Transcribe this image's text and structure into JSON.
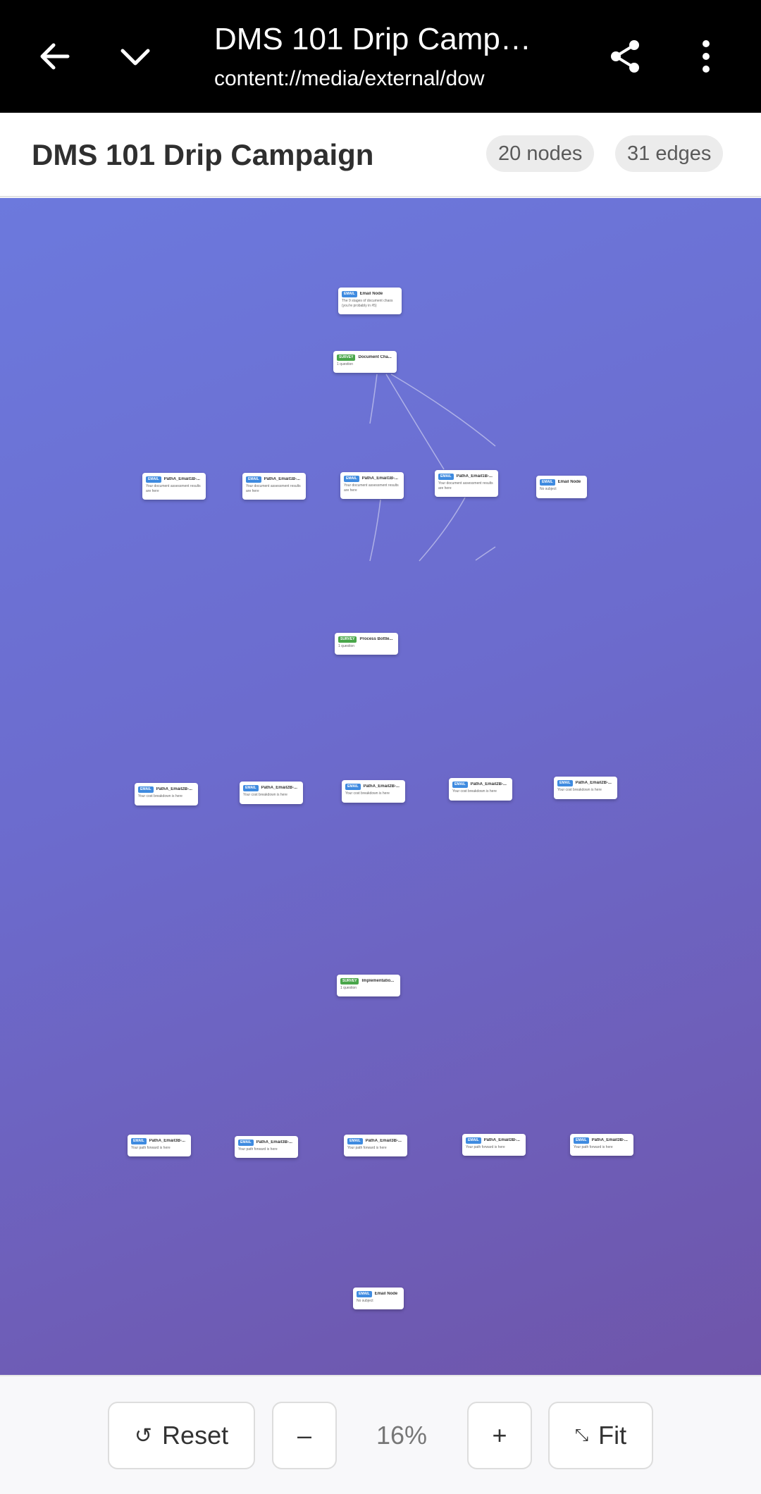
{
  "app_bar": {
    "title": "DMS 101 Drip Campai...",
    "url": "content://media/external/dow",
    "icons": [
      "back-arrow-icon",
      "chevron-down-icon",
      "share-icon",
      "more-vert-icon"
    ]
  },
  "header": {
    "title": "DMS 101 Drip Campaign",
    "nodes_count": "20 nodes",
    "edges_count": "31 edges"
  },
  "graph": {
    "background_colors": [
      "#6c79dd",
      "#6f55aa"
    ],
    "nodes": [
      {
        "type": "EMAIL",
        "title": "Email Node",
        "subtitle": "The 9 stages of document chaos (you're probably in #5)"
      },
      {
        "type": "SURVEY",
        "title": "Document Cha...",
        "subtitle": "1 question"
      },
      {
        "type": "EMAIL",
        "title": "PathA_Email1B-...",
        "subtitle": "Your document assessment results are here"
      },
      {
        "type": "EMAIL",
        "title": "PathA_Email1B-...",
        "subtitle": "Your document assessment results are here"
      },
      {
        "type": "EMAIL",
        "title": "PathA_Email1B-...",
        "subtitle": "Your document assessment results are here"
      },
      {
        "type": "EMAIL",
        "title": "PathA_Email1B-...",
        "subtitle": "Your document assessment results are here"
      },
      {
        "type": "EMAIL",
        "title": "Email Node",
        "subtitle": "No subject"
      },
      {
        "type": "SURVEY",
        "title": "Process Bottle...",
        "subtitle": "1 question"
      },
      {
        "type": "EMAIL",
        "title": "PathA_Email2B-...",
        "subtitle": "Your cost breakdown is here"
      },
      {
        "type": "EMAIL",
        "title": "PathA_Email2B-...",
        "subtitle": "Your cost breakdown is here"
      },
      {
        "type": "EMAIL",
        "title": "PathA_Email2B-...",
        "subtitle": "Your cost breakdown is here"
      },
      {
        "type": "EMAIL",
        "title": "PathA_Email2B-...",
        "subtitle": "Your cost breakdown is here"
      },
      {
        "type": "EMAIL",
        "title": "PathA_Email2B-...",
        "subtitle": "Your cost breakdown is here"
      },
      {
        "type": "SURVEY",
        "title": "Implementatio...",
        "subtitle": "1 question"
      },
      {
        "type": "EMAIL",
        "title": "PathA_Email3B-...",
        "subtitle": "Your path forward is here"
      },
      {
        "type": "EMAIL",
        "title": "PathA_Email3B-...",
        "subtitle": "Your path forward is here"
      },
      {
        "type": "EMAIL",
        "title": "PathA_Email3B-...",
        "subtitle": "Your path forward is here"
      },
      {
        "type": "EMAIL",
        "title": "PathA_Email3B-...",
        "subtitle": "Your path forward is here"
      },
      {
        "type": "EMAIL",
        "title": "PathA_Email3B-...",
        "subtitle": "Your path forward is here"
      },
      {
        "type": "EMAIL",
        "title": "Email Node",
        "subtitle": "No subject"
      }
    ]
  },
  "controls": {
    "reset_label": "Reset",
    "reset_icon": "reset-icon",
    "zoom_out_label": "–",
    "zoom_level": "16%",
    "zoom_in_label": "+",
    "fit_label": "Fit",
    "fit_icon": "fit-icon"
  }
}
